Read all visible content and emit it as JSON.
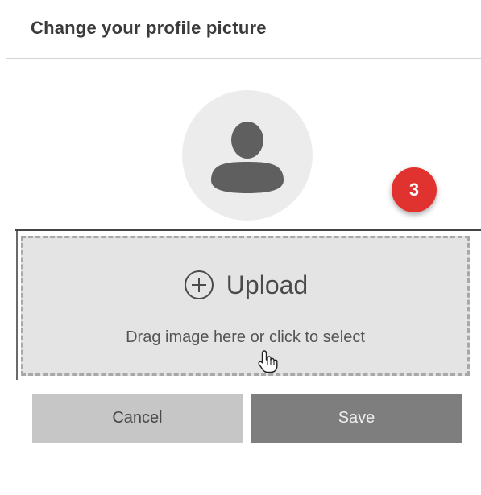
{
  "dialog": {
    "title": "Change your profile picture"
  },
  "avatar": {
    "icon": "user-silhouette-icon"
  },
  "step_badge": {
    "number": "3",
    "color": "#e0322f"
  },
  "dropzone": {
    "icon": "plus-circle-icon",
    "label": "Upload",
    "hint": "Drag image here or click to select",
    "cursor_icon": "hand-pointer-icon"
  },
  "buttons": {
    "cancel_label": "Cancel",
    "save_label": "Save"
  }
}
